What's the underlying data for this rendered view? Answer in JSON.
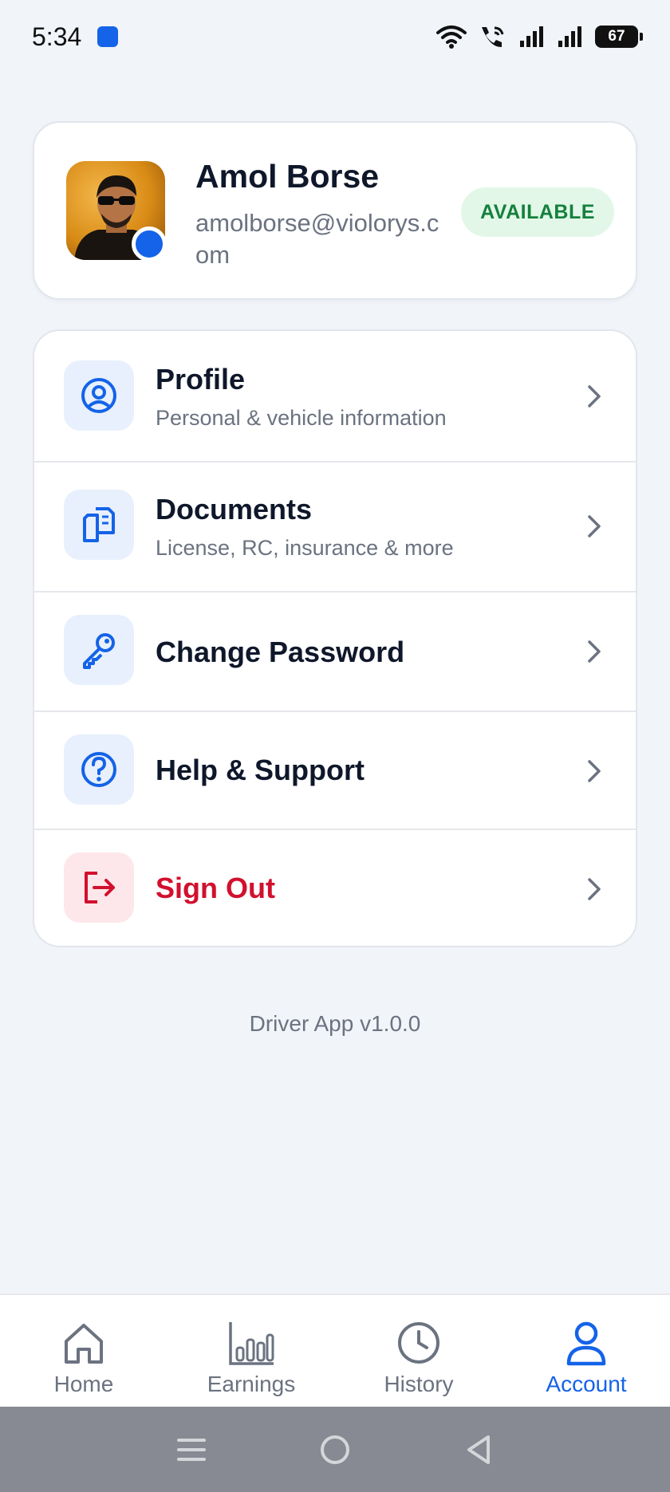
{
  "status_bar": {
    "time": "5:34",
    "battery": "67"
  },
  "profile": {
    "name": "Amol Borse",
    "email": "amolborse@violorys.com",
    "status": "AVAILABLE"
  },
  "menu": [
    {
      "title": "Profile",
      "subtitle": "Personal & vehicle information",
      "icon": "user-circle-icon"
    },
    {
      "title": "Documents",
      "subtitle": "License, RC, insurance & more",
      "icon": "documents-icon"
    },
    {
      "title": "Change Password",
      "subtitle": "",
      "icon": "key-icon"
    },
    {
      "title": "Help & Support",
      "subtitle": "",
      "icon": "help-circle-icon"
    },
    {
      "title": "Sign Out",
      "subtitle": "",
      "icon": "sign-out-icon"
    }
  ],
  "app_version": "Driver App v1.0.0",
  "bottom_nav": [
    {
      "label": "Home",
      "icon": "home-icon",
      "active": false
    },
    {
      "label": "Earnings",
      "icon": "bar-chart-icon",
      "active": false
    },
    {
      "label": "History",
      "icon": "clock-icon",
      "active": false
    },
    {
      "label": "Account",
      "icon": "user-icon",
      "active": true
    }
  ],
  "colors": {
    "accent": "#1463e8",
    "danger": "#d2102e",
    "available_bg": "#e2f7e8",
    "available_text": "#15803d",
    "background": "#f1f4f9"
  }
}
